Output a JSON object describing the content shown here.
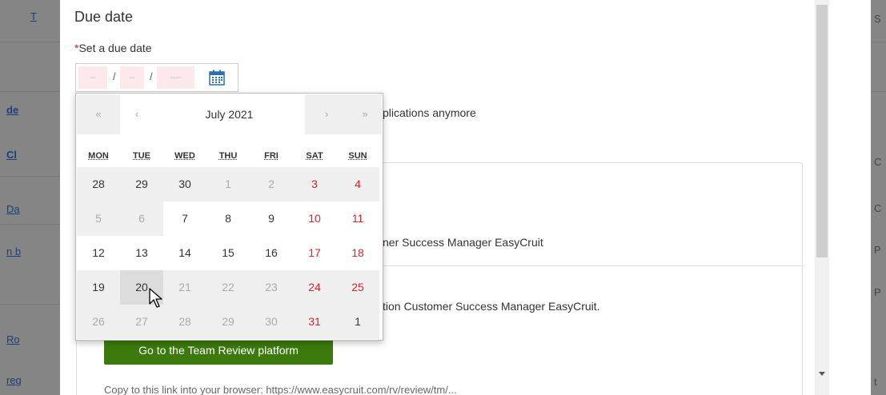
{
  "left_strip": {
    "links": [
      {
        "text": "T",
        "bold": false
      },
      {
        "text": "de",
        "bold": true
      },
      {
        "text": "Cl",
        "bold": true
      },
      {
        "text": "Da",
        "bold": false
      },
      {
        "text": "n b",
        "bold": false
      },
      {
        "text": "Ro",
        "bold": false
      },
      {
        "text": "reg",
        "bold": false
      }
    ]
  },
  "right_strip": {
    "letters": [
      "S",
      "C",
      "C",
      "P",
      "P",
      "t"
    ]
  },
  "modal": {
    "section_title": "Due date",
    "required_marker": "*",
    "field_label": "Set a due date",
    "date_input": {
      "day": "--",
      "month": "--",
      "year": "----",
      "separator": "/",
      "icon": "calendar-icon"
    },
    "behind_texts": [
      "plications anymore",
      "ner Success Manager EasyCruit",
      "tion Customer Success Manager EasyCruit."
    ],
    "go_button_label": "Go to the Team Review platform",
    "faded_text": "Copy to this link into your browser: https://www.easycruit.com/rv/review/tm/..."
  },
  "datepicker": {
    "prev_year": "«",
    "prev_month": "‹",
    "month_label": "July 2021",
    "next_month": "›",
    "next_year": "»",
    "weekdays": [
      "MON",
      "TUE",
      "WED",
      "THU",
      "FRI",
      "SAT",
      "SUN"
    ],
    "weeks": [
      [
        {
          "d": "28",
          "s": "grey-dark"
        },
        {
          "d": "29",
          "s": "grey-dark"
        },
        {
          "d": "30",
          "s": "grey-dark"
        },
        {
          "d": "1",
          "s": "muted"
        },
        {
          "d": "2",
          "s": "muted"
        },
        {
          "d": "3",
          "s": "weekend-grey"
        },
        {
          "d": "4",
          "s": "weekend-grey"
        }
      ],
      [
        {
          "d": "5",
          "s": "muted"
        },
        {
          "d": "6",
          "s": "muted"
        },
        {
          "d": "7",
          "s": "normal"
        },
        {
          "d": "8",
          "s": "normal"
        },
        {
          "d": "9",
          "s": "normal"
        },
        {
          "d": "10",
          "s": "weekend"
        },
        {
          "d": "11",
          "s": "weekend"
        }
      ],
      [
        {
          "d": "12",
          "s": "normal"
        },
        {
          "d": "13",
          "s": "normal"
        },
        {
          "d": "14",
          "s": "normal"
        },
        {
          "d": "15",
          "s": "normal"
        },
        {
          "d": "16",
          "s": "normal"
        },
        {
          "d": "17",
          "s": "weekend"
        },
        {
          "d": "18",
          "s": "weekend"
        }
      ],
      [
        {
          "d": "19",
          "s": "grey-dark"
        },
        {
          "d": "20",
          "s": "hover"
        },
        {
          "d": "21",
          "s": "muted"
        },
        {
          "d": "22",
          "s": "muted"
        },
        {
          "d": "23",
          "s": "muted"
        },
        {
          "d": "24",
          "s": "weekend-grey"
        },
        {
          "d": "25",
          "s": "weekend-grey"
        }
      ],
      [
        {
          "d": "26",
          "s": "muted"
        },
        {
          "d": "27",
          "s": "muted"
        },
        {
          "d": "28",
          "s": "muted"
        },
        {
          "d": "29",
          "s": "muted"
        },
        {
          "d": "30",
          "s": "muted"
        },
        {
          "d": "31",
          "s": "weekend-grey"
        },
        {
          "d": "1",
          "s": "grey-normal"
        }
      ]
    ]
  },
  "colors": {
    "required": "#d9232e",
    "weekend": "#d9232e",
    "button": "#3c7a0d",
    "invalid_bg": "#fde8ec"
  }
}
